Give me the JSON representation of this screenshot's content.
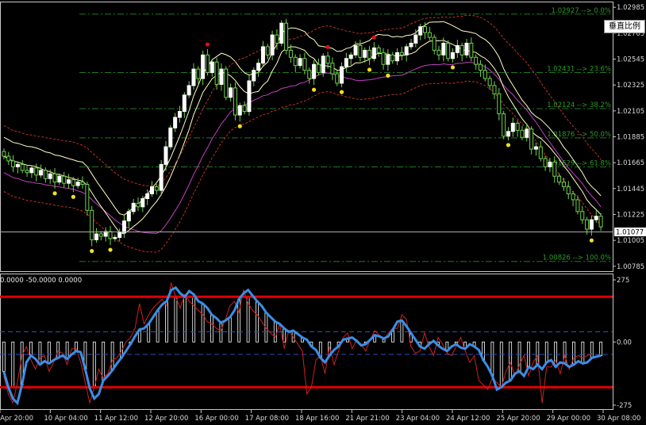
{
  "toolbar": {
    "scale_button": "垂直比例"
  },
  "colors": {
    "bull_candle": "#ffffff",
    "bear_candle": "#ffffff",
    "candle_wick": "#6fd34b",
    "ma_yellow": "#ffffc0",
    "ma_magenta": "#c040c0",
    "band_red": "#c03020",
    "fib": "#1f7a1f",
    "osc_blue": "#3a8ee6",
    "osc_red": "#d02020",
    "osc_level": "#e00000",
    "osc_mid": "#3050c0",
    "current_price_line": "#aaaaaa"
  },
  "chart_data": [
    {
      "type": "candlestick",
      "title": "",
      "price_axis": {
        "ylim": [
          1.0075,
          1.0302
        ],
        "ticks": [
          "1.02985",
          "1.02765",
          "1.02545",
          "1.02325",
          "1.02105",
          "1.01885",
          "1.01665",
          "1.01445",
          "1.01225",
          "1.01005",
          "1.00785"
        ]
      },
      "current_price": "1.01077",
      "fib_levels": [
        {
          "price": 1.02927,
          "label": "1.02927 --> 0.0%"
        },
        {
          "price": 1.02431,
          "label": "1.02431 --> 23.6%"
        },
        {
          "price": 1.02124,
          "label": "1.02124 --> 38.2%"
        },
        {
          "price": 1.01876,
          "label": "1.01876 --> 50.0%"
        },
        {
          "price": 1.01629,
          "label": "1.01629 --> 61.8%"
        },
        {
          "price": 1.00826,
          "label": "1.00826 --> 100.0%"
        }
      ],
      "time_labels": [
        "9 Apr 20:00",
        "10 Apr 04:00",
        "11 Apr 12:00",
        "12 Apr 20:00",
        "16 Apr 00:00",
        "17 Apr 08:00",
        "18 Apr 16:00",
        "21 Apr 21:00",
        "23 Apr 04:00",
        "24 Apr 12:00",
        "25 Apr 20:00",
        "29 Apr 00:00",
        "30 Apr 08:00"
      ],
      "close": [
        1.0172,
        1.0168,
        1.0163,
        1.0165,
        1.016,
        1.0158,
        1.0162,
        1.0156,
        1.016,
        1.0153,
        1.0157,
        1.015,
        1.0155,
        1.0149,
        1.0152,
        1.0147,
        1.015,
        1.0148,
        1.0126,
        1.0101,
        1.0106,
        1.0104,
        1.0108,
        1.0102,
        1.0103,
        1.0107,
        1.0117,
        1.0125,
        1.0132,
        1.0129,
        1.0136,
        1.014,
        1.0146,
        1.0143,
        1.0165,
        1.018,
        1.0196,
        1.0205,
        1.021,
        1.0224,
        1.0232,
        1.0246,
        1.0238,
        1.0258,
        1.0243,
        1.0252,
        1.0233,
        1.0246,
        1.0222,
        1.023,
        1.0207,
        1.0215,
        1.021,
        1.0236,
        1.0245,
        1.0251,
        1.0265,
        1.0258,
        1.0275,
        1.0268,
        1.0285,
        1.0262,
        1.0256,
        1.0249,
        1.0255,
        1.0245,
        1.0238,
        1.025,
        1.0243,
        1.0257,
        1.0251,
        1.0242,
        1.0234,
        1.0248,
        1.0255,
        1.0258,
        1.0266,
        1.0256,
        1.0262,
        1.0255,
        1.0264,
        1.026,
        1.025,
        1.0258,
        1.0253,
        1.026,
        1.0258,
        1.0265,
        1.0268,
        1.0275,
        1.0282,
        1.0277,
        1.0273,
        1.0262,
        1.0258,
        1.0268,
        1.0255,
        1.026,
        1.0266,
        1.0258,
        1.0268,
        1.0256,
        1.025,
        1.0245,
        1.0238,
        1.0232,
        1.0225,
        1.0208,
        1.0189,
        1.0193,
        1.02,
        1.0194,
        1.0188,
        1.0195,
        1.0178,
        1.018,
        1.017,
        1.0163,
        1.0167,
        1.0155,
        1.015,
        1.0146,
        1.014,
        1.0135,
        1.0125,
        1.0118,
        1.011,
        1.0118,
        1.0121,
        1.0112
      ]
    },
    {
      "type": "line",
      "title": "",
      "header": "0.0000 -50.0000 0.0000",
      "ylim": [
        -290,
        285
      ],
      "tick_labels": [
        "275",
        "0.00",
        "-275"
      ],
      "levels": [
        200,
        -200
      ],
      "mid_levels": [
        45,
        -55
      ],
      "series": [
        {
          "values": [
            -130,
            -200,
            -250,
            -270,
            -190,
            -90,
            -60,
            -75,
            -100,
            -85,
            -95,
            -80,
            -70,
            -60,
            -75,
            -55,
            -40,
            -45,
            -120,
            -205,
            -250,
            -230,
            -170,
            -150,
            -125,
            -95,
            -70,
            -40,
            -10,
            25,
            55,
            60,
            80,
            110,
            140,
            165,
            180,
            230,
            240,
            215,
            200,
            225,
            210,
            180,
            170,
            150,
            120,
            105,
            85,
            95,
            110,
            140,
            190,
            215,
            230,
            205,
            180,
            160,
            130,
            110,
            90,
            80,
            60,
            45,
            50,
            35,
            20,
            10,
            -20,
            -35,
            -70,
            -90,
            -60,
            -35,
            -20,
            10,
            15,
            20,
            5,
            -15,
            -10,
            10,
            30,
            25,
            15,
            25,
            55,
            90,
            95,
            70,
            40,
            10,
            -20,
            -30,
            -10,
            5,
            -15,
            -30,
            -40,
            -20,
            -10,
            -25,
            -30,
            -10,
            -20,
            -35,
            -80,
            -110,
            -150,
            -210,
            -200,
            -180,
            -170,
            -140,
            -130,
            -150,
            -110,
            -120,
            -100,
            -120,
            -90,
            -80,
            -110,
            -90,
            -95,
            -110,
            -100,
            -85,
            -95,
            -90,
            -70,
            -65,
            -60
          ]
        },
        {
          "values": [
            -150,
            -230,
            -270,
            -180,
            -60,
            -20,
            -80,
            -120,
            -70,
            -60,
            -130,
            -90,
            -40,
            -50,
            -100,
            -30,
            -30,
            -90,
            -180,
            -270,
            -200,
            -120,
            -160,
            -140,
            -80,
            -70,
            -40,
            0,
            20,
            60,
            170,
            80,
            120,
            150,
            170,
            190,
            160,
            260,
            200,
            150,
            210,
            180,
            160,
            140,
            120,
            90,
            80,
            60,
            50,
            100,
            160,
            180,
            130,
            230,
            170,
            140,
            120,
            90,
            60,
            40,
            20,
            80,
            -30,
            50,
            20,
            -10,
            -40,
            -230,
            -200,
            -80,
            -60,
            -140,
            -20,
            -100,
            -40,
            20,
            40,
            -30,
            10,
            -10,
            -40,
            10,
            50,
            30,
            10,
            40,
            60,
            60,
            120,
            100,
            -20,
            -50,
            -40,
            40,
            -20,
            -60,
            20,
            -10,
            -50,
            -60,
            -20,
            20,
            -40,
            -90,
            -60,
            -170,
            -190,
            -210,
            -160,
            -180,
            -200,
            -130,
            -90,
            -150,
            -100,
            -60,
            -150,
            -90,
            -60,
            -270,
            -110,
            -110,
            -80,
            -140,
            -60,
            -120,
            -70,
            -60,
            -70,
            -60,
            -50
          ]
        }
      ]
    }
  ]
}
